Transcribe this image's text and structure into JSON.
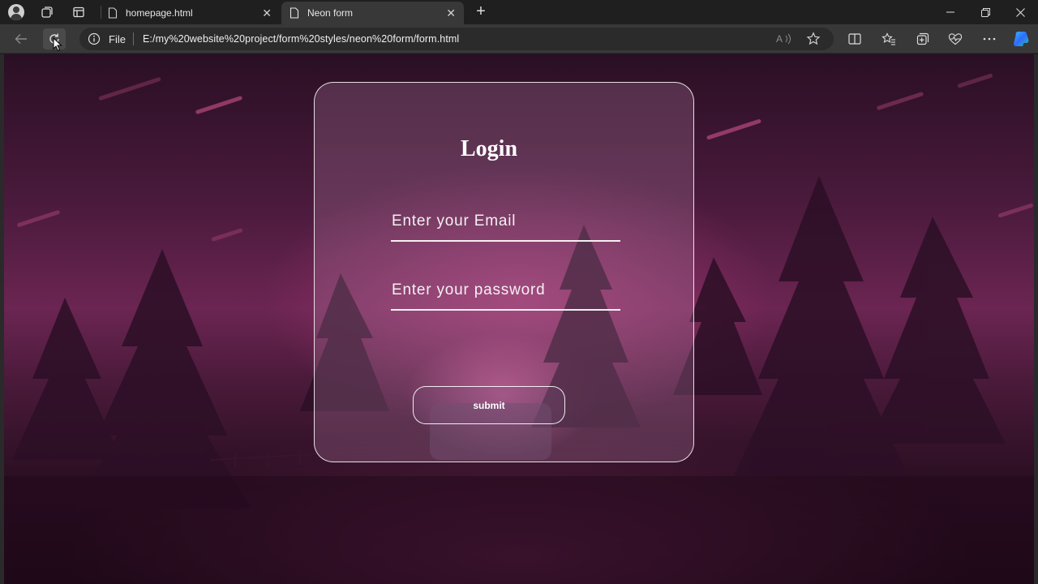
{
  "browser": {
    "tabs": [
      {
        "label": "homepage.html",
        "active": false
      },
      {
        "label": "Neon form",
        "active": true
      }
    ],
    "address": {
      "scheme_label": "File",
      "url": "E:/my%20website%20project/form%20styles/neon%20form/form.html"
    }
  },
  "page": {
    "title": "Login",
    "email_placeholder": "Enter your Email",
    "password_placeholder": "Enter your password",
    "submit_label": "submit"
  },
  "colors": {
    "accent": "#c2457f",
    "background_dark": "#2a0f24",
    "card_border": "#ffffff"
  }
}
